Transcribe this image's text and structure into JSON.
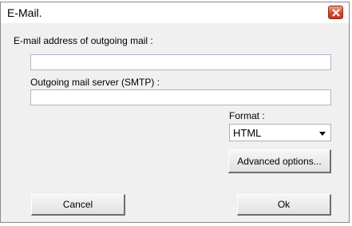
{
  "window": {
    "title": "E-Mail."
  },
  "form": {
    "sender_label": "E-mail address of outgoing mail :",
    "sender_value": "",
    "smtp_label": "Outgoing mail server (SMTP) :",
    "smtp_value": "",
    "format_label": "Format :",
    "format_value": "HTML"
  },
  "buttons": {
    "advanced": "Advanced options...",
    "cancel": "Cancel",
    "ok": "Ok"
  },
  "icons": {
    "close": "close-icon",
    "dropdown": "chevron-down-icon"
  },
  "colors": {
    "close_button": "#d24a2c",
    "dialog_background": "#f0f0f0"
  }
}
